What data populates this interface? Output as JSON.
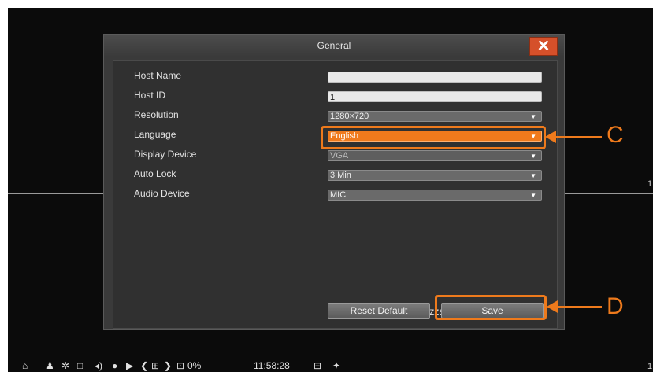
{
  "dialog": {
    "title": "General",
    "close_icon": "close-icon",
    "fields": {
      "host_name": {
        "label": "Host Name",
        "value": ""
      },
      "host_id": {
        "label": "Host ID",
        "value": "1"
      },
      "resolution": {
        "label": "Resolution",
        "value": "1280×720"
      },
      "language": {
        "label": "Language",
        "value": "English"
      },
      "display_device": {
        "label": "Display Device",
        "value": "VGA"
      },
      "auto_lock": {
        "label": "Auto Lock",
        "value": "3 Min"
      },
      "audio_device": {
        "label": "Audio Device",
        "value": "MIC"
      }
    },
    "wizard_checkbox": {
      "label": "Display Power On Wizzard",
      "checked": true
    },
    "buttons": {
      "reset": "Reset Default",
      "save": "Save"
    }
  },
  "callouts": {
    "c": "C",
    "d": "D"
  },
  "taskbar": {
    "percent": "0%",
    "time": "11:58:28"
  },
  "edge": {
    "right_mid": "1",
    "right_bottom": "1"
  },
  "colors": {
    "accent": "#ee7a1c",
    "close": "#d5502a"
  }
}
